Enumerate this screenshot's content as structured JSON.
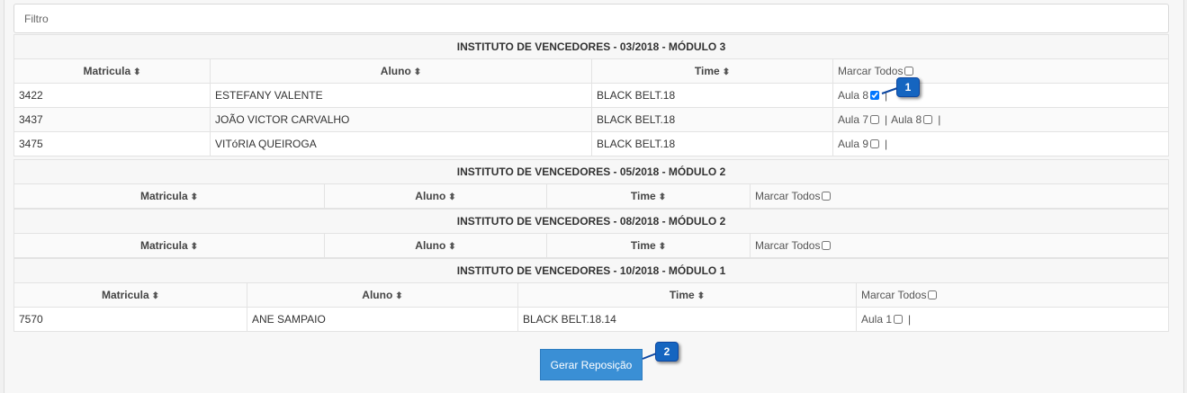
{
  "filter": {
    "placeholder": "Filtro"
  },
  "headers": {
    "matricula": "Matricula",
    "aluno": "Aluno",
    "time": "Time",
    "marcar": "Marcar Todos"
  },
  "groups": [
    {
      "title": "INSTITUTO DE VENCEDORES - 03/2018 - MÓDULO 3",
      "rows": [
        {
          "matricula": "3422",
          "aluno": "ESTEFANY VALENTE",
          "time": "BLACK BELT.18",
          "aulas": [
            {
              "label": "Aula 8",
              "checked": true
            }
          ]
        },
        {
          "matricula": "3437",
          "aluno": "JOÃO VICTOR CARVALHO",
          "time": "BLACK BELT.18",
          "aulas": [
            {
              "label": "Aula 7",
              "checked": false
            },
            {
              "label": "Aula 8",
              "checked": false
            }
          ]
        },
        {
          "matricula": "3475",
          "aluno": "VITóRIA QUEIROGA",
          "time": "BLACK BELT.18",
          "aulas": [
            {
              "label": "Aula 9",
              "checked": false
            }
          ]
        }
      ]
    },
    {
      "title": "INSTITUTO DE VENCEDORES - 05/2018 - MÓDULO 2",
      "rows": []
    },
    {
      "title": "INSTITUTO DE VENCEDORES - 08/2018 - MÓDULO 2",
      "rows": []
    },
    {
      "title": "INSTITUTO DE VENCEDORES - 10/2018 - MÓDULO 1",
      "rows": [
        {
          "matricula": "7570",
          "aluno": "ANE SAMPAIO",
          "time": "BLACK BELT.18.14",
          "aulas": [
            {
              "label": "Aula 1",
              "checked": false
            }
          ]
        }
      ]
    }
  ],
  "button": {
    "label": "Gerar Reposição"
  },
  "callouts": {
    "one": "1",
    "two": "2"
  },
  "icons": {
    "sort": "sort-icon"
  },
  "colors": {
    "button": "#3a8fd5",
    "badge": "#1565c0"
  }
}
